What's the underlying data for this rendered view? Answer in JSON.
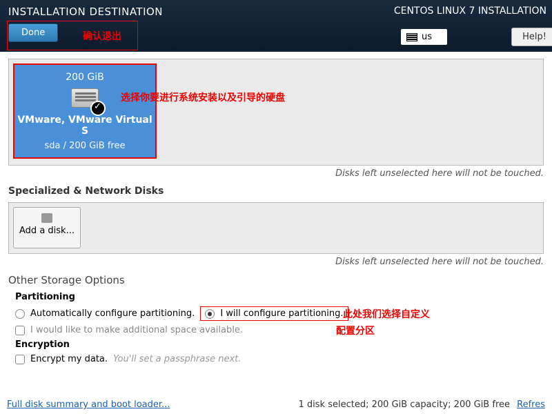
{
  "header": {
    "title": "INSTALLATION DESTINATION",
    "subtitle": "CENTOS LINUX 7 INSTALLATION",
    "done": "Done",
    "kb_layout": "us",
    "help": "Help!"
  },
  "annotations": {
    "confirm_exit": "确认退出",
    "select_disk": "选择你要进行系统安装以及引导的硬盘",
    "custom_partition_line1": "此处我们选择自定义",
    "custom_partition_line2": "配置分区"
  },
  "disk": {
    "size": "200 GiB",
    "name": "VMware, VMware Virtual S",
    "sub": "sda   /   200 GiB free"
  },
  "hints": {
    "unselected": "Disks left unselected here will not be touched."
  },
  "sections": {
    "specialized": "Specialized & Network Disks",
    "add_disk": "Add a disk...",
    "other_storage": "Other Storage Options",
    "partitioning": "Partitioning",
    "encryption": "Encryption"
  },
  "options": {
    "auto_partition": "Automatically configure partitioning.",
    "manual_partition": "I will configure partitioning.",
    "additional_space": "I would like to make additional space available.",
    "encrypt": "Encrypt my data.",
    "encrypt_note": "You'll set a passphrase next."
  },
  "footer": {
    "summary": "Full disk summary and boot loader...",
    "status": "1 disk selected; 200 GiB capacity; 200 GiB free",
    "refresh": "Refres"
  }
}
